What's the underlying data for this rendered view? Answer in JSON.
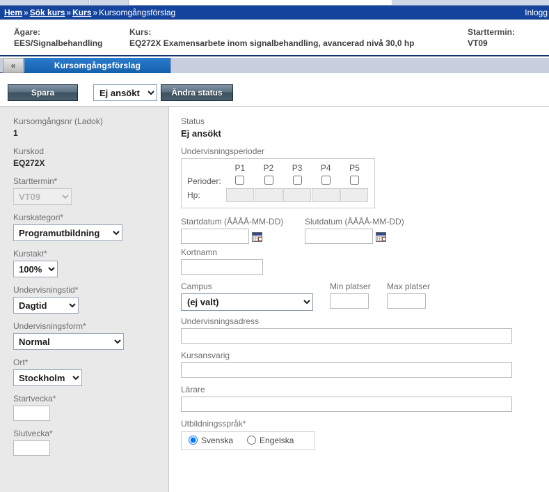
{
  "browser": {
    "tab_stub_label": ""
  },
  "breadcrumb": {
    "items": [
      {
        "label": "Hem",
        "link": true
      },
      {
        "label": "Sök kurs",
        "link": true
      },
      {
        "label": "Kurs",
        "link": true
      },
      {
        "label": "Kursomgångsförslag",
        "link": false
      }
    ],
    "separator": "»",
    "login_status": "Inlogg"
  },
  "course_header": {
    "owner_label": "Ägare:",
    "owner_value": "EES/Signalbehandling",
    "course_label": "Kurs:",
    "course_value": "EQ272X Examensarbete inom signalbehandling, avancerad nivå 30,0 hp",
    "term_label": "Starttermin:",
    "term_value": "VT09"
  },
  "tabs": {
    "collapse_label": "«",
    "active_tab": "Kursomgångsförslag"
  },
  "toolbar": {
    "save_label": "Spara",
    "status_value": "Ej ansökt",
    "status_options": [
      "Ej ansökt"
    ],
    "change_status_label": "Ändra status"
  },
  "sidebar": {
    "kursomgangsnr_label": "Kursomgångsnr (Ladok)",
    "kursomgangsnr_value": "1",
    "kurskod_label": "Kurskod",
    "kurskod_value": "EQ272X",
    "starttermin_label": "Starttermin*",
    "starttermin_value": "VT09",
    "starttermin_options": [
      "VT09"
    ],
    "kurskategori_label": "Kurskategori*",
    "kurskategori_value": "Programutbildning",
    "kurskategori_options": [
      "Programutbildning"
    ],
    "kurstakt_label": "Kurstakt*",
    "kurstakt_value": "100%",
    "kurstakt_options": [
      "100%"
    ],
    "undervisningstid_label": "Undervisningstid*",
    "undervisningstid_value": "Dagtid",
    "undervisningstid_options": [
      "Dagtid"
    ],
    "undervisningsform_label": "Undervisningsform*",
    "undervisningsform_value": "Normal",
    "undervisningsform_options": [
      "Normal"
    ],
    "ort_label": "Ort*",
    "ort_value": "Stockholm",
    "ort_options": [
      "Stockholm"
    ],
    "startvecka_label": "Startvecka*",
    "startvecka_value": "",
    "slutvecka_label": "Slutvecka*",
    "slutvecka_value": ""
  },
  "content": {
    "status_label": "Status",
    "status_value": "Ej ansökt",
    "periods_label": "Undervisningsperioder",
    "periods_columns": [
      "P1",
      "P2",
      "P3",
      "P4",
      "P5"
    ],
    "periods_row_label": "Perioder:",
    "periods_checked": [
      false,
      false,
      false,
      false,
      false
    ],
    "hp_row_label": "Hp:",
    "hp_values": [
      "",
      "",
      "",
      "",
      ""
    ],
    "startdatum_label": "Startdatum (ÅÅÅÅ-MM-DD)",
    "startdatum_value": "",
    "slutdatum_label": "Slutdatum (ÅÅÅÅ-MM-DD)",
    "slutdatum_value": "",
    "kortnamn_label": "Kortnamn",
    "kortnamn_value": "",
    "campus_label": "Campus",
    "campus_value": "(ej valt)",
    "campus_options": [
      "(ej valt)"
    ],
    "min_platser_label": "Min platser",
    "min_platser_value": "",
    "max_platser_label": "Max platser",
    "max_platser_value": "",
    "undervisningsadress_label": "Undervisningsadress",
    "undervisningsadress_value": "",
    "kursansvarig_label": "Kursansvarig",
    "kursansvarig_value": "",
    "larare_label": "Lärare",
    "larare_value": "",
    "utbildningssprak_label": "Utbildningsspråk*",
    "utbildningssprak_options": [
      {
        "label": "Svenska",
        "selected": true
      },
      {
        "label": "Engelska",
        "selected": false
      }
    ]
  },
  "colors": {
    "breadcrumb_bar": "#14449e",
    "active_tab": "#1f6fc0",
    "tab_strip": "#c8cede",
    "sidebar": "#e9e9e9",
    "button_gradient_dark": "#3d5261"
  }
}
